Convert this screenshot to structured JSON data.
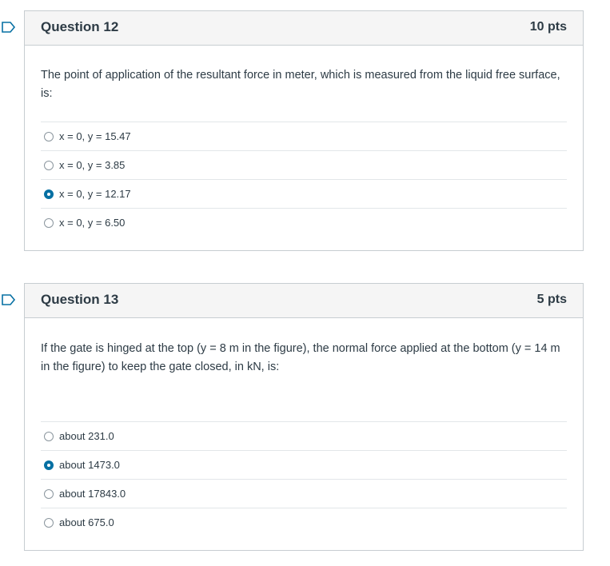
{
  "accent_color": "#0770a3",
  "questions": [
    {
      "title": "Question 12",
      "points": "10 pts",
      "text": "The point of application of the resultant force in meter, which is measured from the liquid free surface,  is:",
      "flag_icon": "bookmark-flag-icon",
      "answers": [
        {
          "label": "x = 0, y = 15.47",
          "selected": false
        },
        {
          "label": "x = 0, y = 3.85",
          "selected": false
        },
        {
          "label": "x = 0, y = 12.17",
          "selected": true
        },
        {
          "label": "x = 0, y = 6.50",
          "selected": false
        }
      ]
    },
    {
      "title": "Question 13",
      "points": "5 pts",
      "text": "If the gate is hinged at the top (y = 8 m in the figure), the normal force applied at the bottom (y = 14 m in the figure) to keep the gate closed, in kN, is:",
      "flag_icon": "bookmark-flag-icon",
      "answers": [
        {
          "label": "about 231.0",
          "selected": false
        },
        {
          "label": "about 1473.0",
          "selected": true
        },
        {
          "label": "about 17843.0",
          "selected": false
        },
        {
          "label": "about 675.0",
          "selected": false
        }
      ]
    }
  ]
}
